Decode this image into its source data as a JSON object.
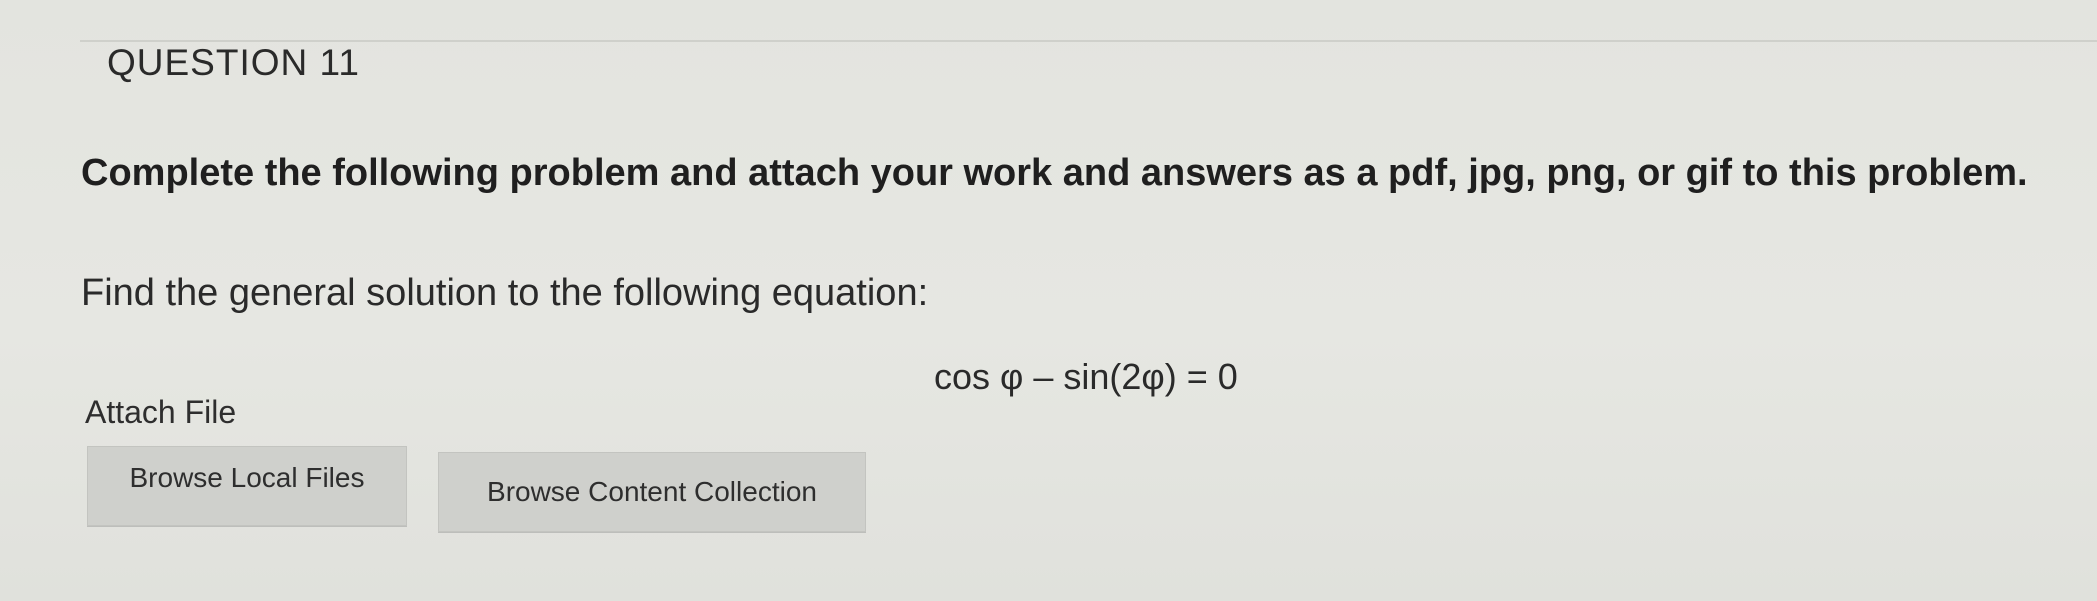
{
  "question": {
    "title": "QUESTION 11"
  },
  "problem": {
    "instructions": "Complete the following problem and attach your work and answers as a pdf, jpg, png, or gif to this problem.",
    "prompt": "Find the general solution to the following equation:",
    "equation": "cos φ – sin(2φ)  =  0"
  },
  "attachment": {
    "label": "Attach File",
    "browse_local_label": "Browse Local Files",
    "browse_collection_label": "Browse Content Collection"
  }
}
